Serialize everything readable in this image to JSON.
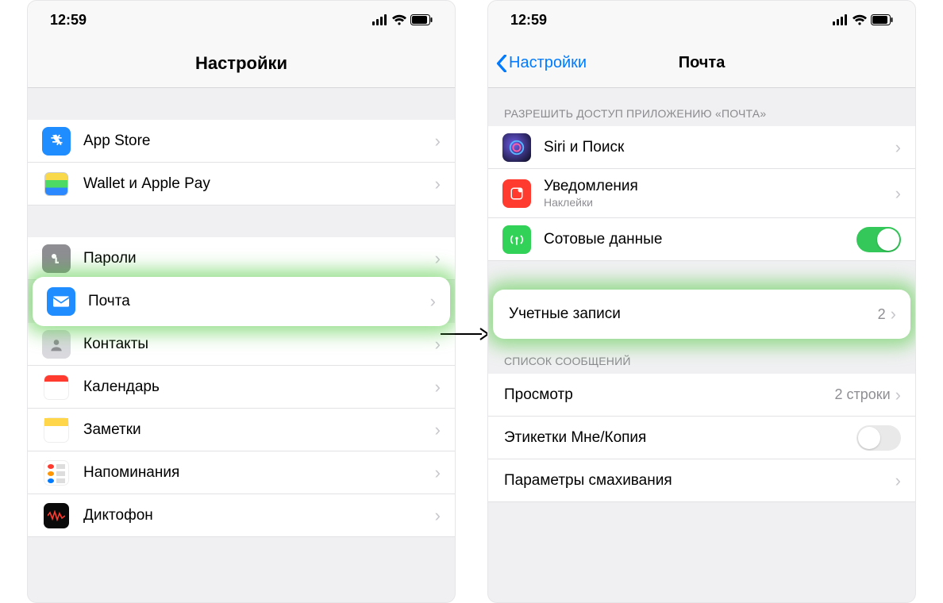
{
  "status": {
    "time": "12:59"
  },
  "left": {
    "title": "Настройки",
    "group1": [
      {
        "label": "App Store"
      },
      {
        "label": "Wallet и Apple Pay"
      }
    ],
    "group2": [
      {
        "label": "Пароли"
      },
      {
        "label": "Почта"
      },
      {
        "label": "Контакты"
      },
      {
        "label": "Календарь"
      },
      {
        "label": "Заметки"
      },
      {
        "label": "Напоминания"
      },
      {
        "label": "Диктофон"
      }
    ]
  },
  "right": {
    "back": "Настройки",
    "title": "Почта",
    "section_access": "РАЗРЕШИТЬ ДОСТУП ПРИЛОЖЕНИЮ «ПОЧТА»",
    "rows_access": {
      "siri": "Siri и Поиск",
      "notifications": "Уведомления",
      "notifications_sub": "Наклейки",
      "cellular": "Сотовые данные"
    },
    "accounts": {
      "label": "Учетные записи",
      "count": "2"
    },
    "section_list": "СПИСОК СООБЩЕНИЙ",
    "rows_list": {
      "preview": "Просмотр",
      "preview_detail": "2 строки",
      "tocc": "Этикетки Мне/Копия",
      "swipe": "Параметры смахивания"
    }
  }
}
